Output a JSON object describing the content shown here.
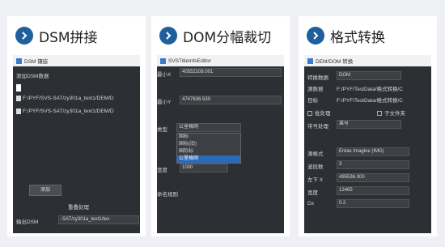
{
  "panels": [
    {
      "title": "DSM拼接"
    },
    {
      "title": "DOM分幅裁切"
    },
    {
      "title": "格式转换"
    }
  ],
  "dsm": {
    "window_title": "DSM 镶嵌",
    "section": "添加DSM数据",
    "files": [
      "F:/PYF/SVS-SAT/zy301a_text1/DEM/D",
      "F:/PYF/SVS-SAT/zy301a_text1/DEM/D"
    ],
    "add_button": "添加",
    "overlap_label": "重叠处理",
    "output_label": "输出DSM",
    "output_value": "-SAT/zy301a_text1/tex"
  },
  "dom": {
    "window_title": "SVSTitleInfoEditor",
    "min_x_label": "最小X",
    "min_x_value": "40552108.001",
    "min_y_label": "最小Y",
    "min_y_value": "4747636.530",
    "type_label": "类型",
    "type_value": "公里格网",
    "options": [
      "国标",
      "国标(旧)",
      "国际标",
      "公里格网"
    ],
    "width_label": "宽度",
    "width_value": "1000",
    "naming_label": "命名规则"
  },
  "fmt": {
    "window_title": "DEM/DOM 转换",
    "rows": [
      {
        "label": "转换数据",
        "value": "DOM"
      },
      {
        "label": "源数据",
        "value": "F:/PYF/TestData/格式转换/C"
      },
      {
        "label": "目标",
        "value": "F:/PYF/TestData/格式转换/C"
      }
    ],
    "check1": "批处理",
    "check2": "子文件夹",
    "proj_label": "带号处理",
    "proj_value": "某号",
    "fmt_label": "源格式",
    "fmt_value": "Erdas Imagine (IMG)",
    "band_label": "波段数",
    "band_value": "3",
    "lr_label": "左下 X",
    "lr_value": "495536.000",
    "width_label": "宽度",
    "width_value": "12465",
    "dx_label": "Dx",
    "dx_value": "0.2"
  }
}
